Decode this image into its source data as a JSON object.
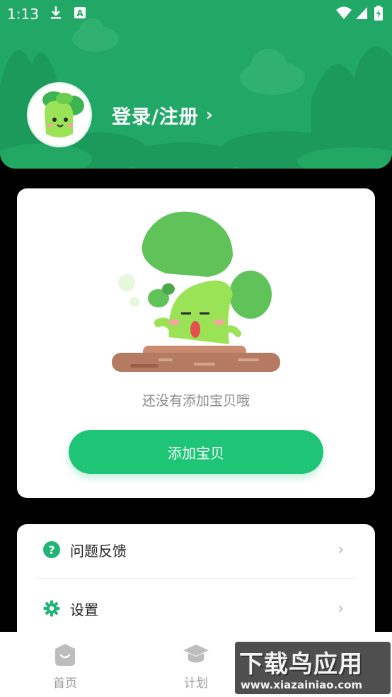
{
  "status_bar": {
    "time": "1:13",
    "icons": [
      "download-icon",
      "a-notification-icon",
      "wifi-icon",
      "signal-icon",
      "battery-icon"
    ]
  },
  "header": {
    "login_label": "登录/注册",
    "chevron": "›"
  },
  "empty_state": {
    "message": "还没有添加宝贝哦",
    "add_button_label": "添加宝贝"
  },
  "menu": {
    "items": [
      {
        "label": "问题反馈",
        "icon": "help-circle-icon",
        "chevron": "›"
      },
      {
        "label": "设置",
        "icon": "gear-icon",
        "chevron": "›"
      }
    ]
  },
  "tabbar": {
    "items": [
      {
        "label": "首页",
        "icon": "home-face-icon"
      },
      {
        "label": "计划",
        "icon": "graduation-cap-icon"
      }
    ]
  },
  "watermark": {
    "title": "下载鸟应用",
    "url": "www.xiazainiao.com"
  },
  "colors": {
    "brand_green": "#21a866",
    "button_green": "#1ec577",
    "leaf_green": "#5fc35a"
  }
}
